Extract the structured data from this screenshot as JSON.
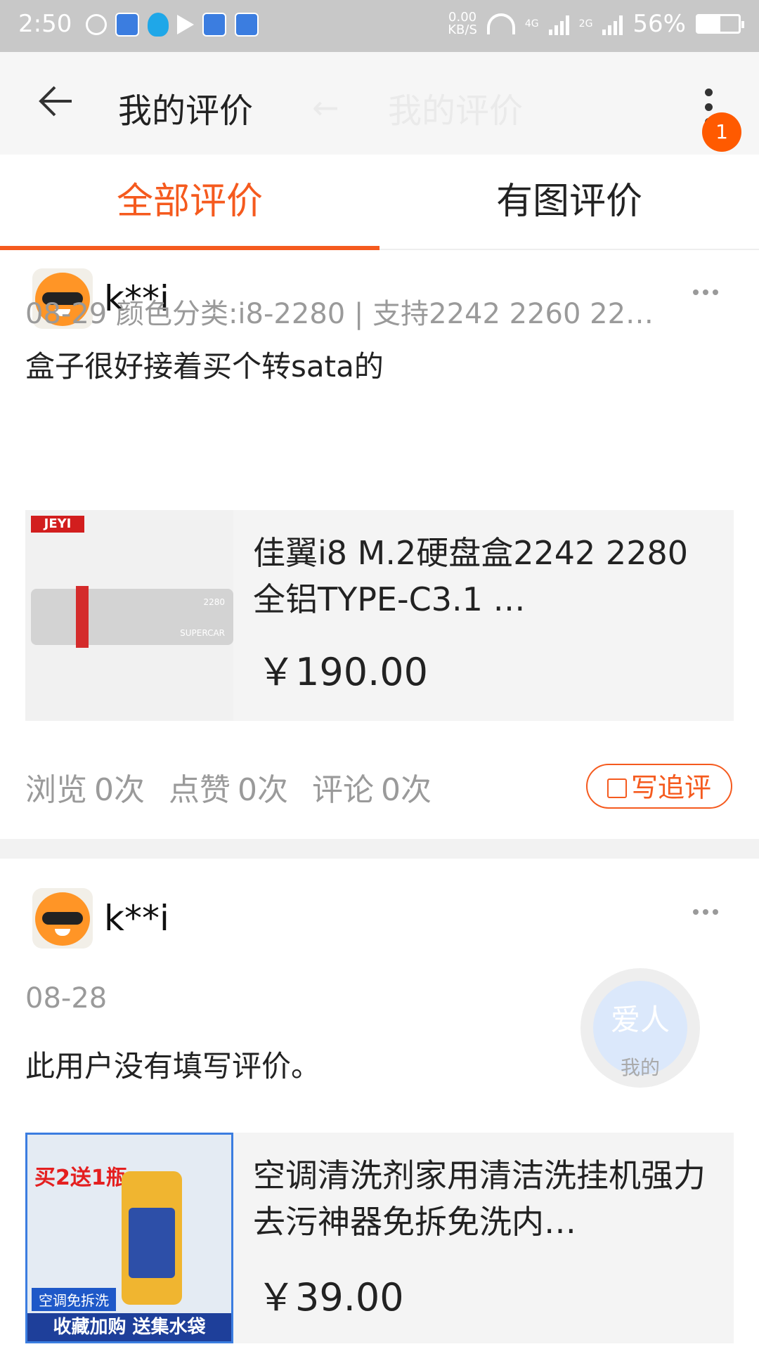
{
  "status_bar": {
    "time": "2:50",
    "net_speed_value": "0.00",
    "net_speed_unit": "KB/S",
    "net_4g": "4G",
    "net_2g": "2G",
    "battery_percent": "56%",
    "battery_level": 0.56
  },
  "app_bar": {
    "title": "我的评价",
    "ghost_title": "我的评价",
    "notification_count": "1"
  },
  "tabs": {
    "all": "全部评价",
    "with_images": "有图评价",
    "active": "all"
  },
  "reviews": [
    {
      "username": "k**i",
      "meta": "08-29 颜色分类:i8-2280 | 支持2242  2260  22…",
      "content": "盒子很好接着买个转sata的",
      "product": {
        "title": "佳翼i8 M.2硬盘盒2242 2280 全铝TYPE-C3.1 …",
        "price": "￥190.00",
        "brand_logo": "JEYI",
        "image_text": "SUPERCAR",
        "image_model": "2280"
      },
      "stats": {
        "views_label": "浏览",
        "views_value": "0次",
        "likes_label": "点赞",
        "likes_value": "0次",
        "comments_label": "评论",
        "comments_value": "0次"
      },
      "followup_label": "写追评"
    },
    {
      "username": "k**i",
      "meta": "08-28",
      "content": "此用户没有填写评价。",
      "stamp_big": "爱人",
      "stamp_small": "我的",
      "product": {
        "title": "空调清洗剂家用清洁洗挂机强力去污神器免拆免洗内…",
        "price": "￥39.00",
        "image_top_text": "买2送1瓶",
        "image_mid_text": "空调免拆洗",
        "image_bottom_text": "收藏加购 送集水袋"
      }
    }
  ],
  "colors": {
    "accent": "#f55a1e",
    "badge": "#ff5a00",
    "status_bar": "#c8c8c8"
  }
}
